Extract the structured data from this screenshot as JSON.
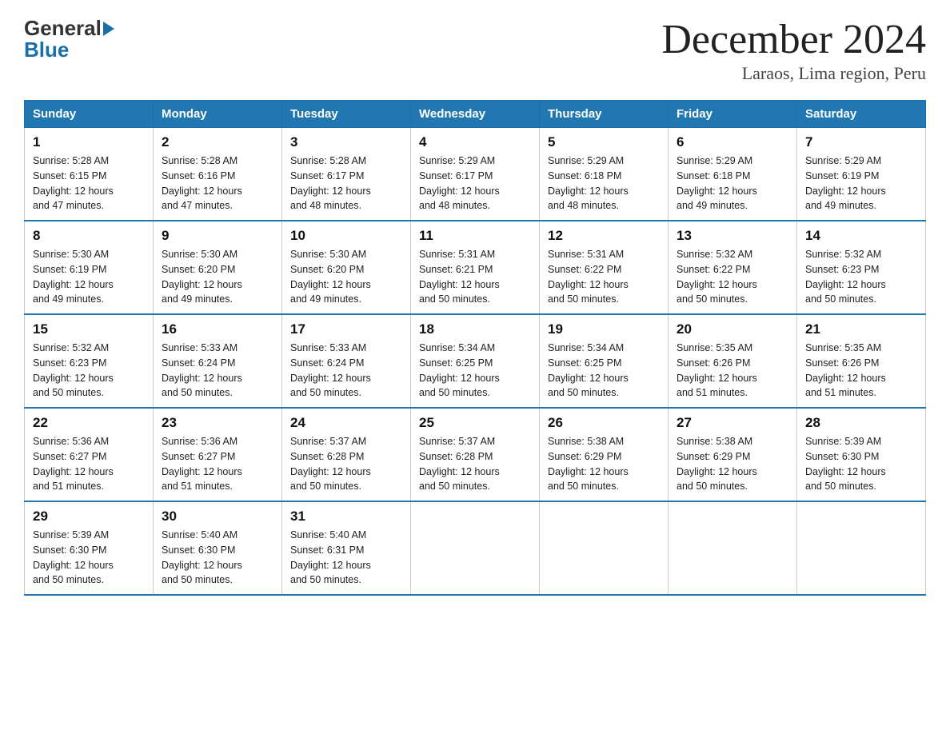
{
  "logo": {
    "general": "General",
    "blue": "Blue"
  },
  "title": "December 2024",
  "subtitle": "Laraos, Lima region, Peru",
  "days_of_week": [
    "Sunday",
    "Monday",
    "Tuesday",
    "Wednesday",
    "Thursday",
    "Friday",
    "Saturday"
  ],
  "weeks": [
    [
      {
        "day": "1",
        "sunrise": "5:28 AM",
        "sunset": "6:15 PM",
        "daylight": "12 hours and 47 minutes."
      },
      {
        "day": "2",
        "sunrise": "5:28 AM",
        "sunset": "6:16 PM",
        "daylight": "12 hours and 47 minutes."
      },
      {
        "day": "3",
        "sunrise": "5:28 AM",
        "sunset": "6:17 PM",
        "daylight": "12 hours and 48 minutes."
      },
      {
        "day": "4",
        "sunrise": "5:29 AM",
        "sunset": "6:17 PM",
        "daylight": "12 hours and 48 minutes."
      },
      {
        "day": "5",
        "sunrise": "5:29 AM",
        "sunset": "6:18 PM",
        "daylight": "12 hours and 48 minutes."
      },
      {
        "day": "6",
        "sunrise": "5:29 AM",
        "sunset": "6:18 PM",
        "daylight": "12 hours and 49 minutes."
      },
      {
        "day": "7",
        "sunrise": "5:29 AM",
        "sunset": "6:19 PM",
        "daylight": "12 hours and 49 minutes."
      }
    ],
    [
      {
        "day": "8",
        "sunrise": "5:30 AM",
        "sunset": "6:19 PM",
        "daylight": "12 hours and 49 minutes."
      },
      {
        "day": "9",
        "sunrise": "5:30 AM",
        "sunset": "6:20 PM",
        "daylight": "12 hours and 49 minutes."
      },
      {
        "day": "10",
        "sunrise": "5:30 AM",
        "sunset": "6:20 PM",
        "daylight": "12 hours and 49 minutes."
      },
      {
        "day": "11",
        "sunrise": "5:31 AM",
        "sunset": "6:21 PM",
        "daylight": "12 hours and 50 minutes."
      },
      {
        "day": "12",
        "sunrise": "5:31 AM",
        "sunset": "6:22 PM",
        "daylight": "12 hours and 50 minutes."
      },
      {
        "day": "13",
        "sunrise": "5:32 AM",
        "sunset": "6:22 PM",
        "daylight": "12 hours and 50 minutes."
      },
      {
        "day": "14",
        "sunrise": "5:32 AM",
        "sunset": "6:23 PM",
        "daylight": "12 hours and 50 minutes."
      }
    ],
    [
      {
        "day": "15",
        "sunrise": "5:32 AM",
        "sunset": "6:23 PM",
        "daylight": "12 hours and 50 minutes."
      },
      {
        "day": "16",
        "sunrise": "5:33 AM",
        "sunset": "6:24 PM",
        "daylight": "12 hours and 50 minutes."
      },
      {
        "day": "17",
        "sunrise": "5:33 AM",
        "sunset": "6:24 PM",
        "daylight": "12 hours and 50 minutes."
      },
      {
        "day": "18",
        "sunrise": "5:34 AM",
        "sunset": "6:25 PM",
        "daylight": "12 hours and 50 minutes."
      },
      {
        "day": "19",
        "sunrise": "5:34 AM",
        "sunset": "6:25 PM",
        "daylight": "12 hours and 50 minutes."
      },
      {
        "day": "20",
        "sunrise": "5:35 AM",
        "sunset": "6:26 PM",
        "daylight": "12 hours and 51 minutes."
      },
      {
        "day": "21",
        "sunrise": "5:35 AM",
        "sunset": "6:26 PM",
        "daylight": "12 hours and 51 minutes."
      }
    ],
    [
      {
        "day": "22",
        "sunrise": "5:36 AM",
        "sunset": "6:27 PM",
        "daylight": "12 hours and 51 minutes."
      },
      {
        "day": "23",
        "sunrise": "5:36 AM",
        "sunset": "6:27 PM",
        "daylight": "12 hours and 51 minutes."
      },
      {
        "day": "24",
        "sunrise": "5:37 AM",
        "sunset": "6:28 PM",
        "daylight": "12 hours and 50 minutes."
      },
      {
        "day": "25",
        "sunrise": "5:37 AM",
        "sunset": "6:28 PM",
        "daylight": "12 hours and 50 minutes."
      },
      {
        "day": "26",
        "sunrise": "5:38 AM",
        "sunset": "6:29 PM",
        "daylight": "12 hours and 50 minutes."
      },
      {
        "day": "27",
        "sunrise": "5:38 AM",
        "sunset": "6:29 PM",
        "daylight": "12 hours and 50 minutes."
      },
      {
        "day": "28",
        "sunrise": "5:39 AM",
        "sunset": "6:30 PM",
        "daylight": "12 hours and 50 minutes."
      }
    ],
    [
      {
        "day": "29",
        "sunrise": "5:39 AM",
        "sunset": "6:30 PM",
        "daylight": "12 hours and 50 minutes."
      },
      {
        "day": "30",
        "sunrise": "5:40 AM",
        "sunset": "6:30 PM",
        "daylight": "12 hours and 50 minutes."
      },
      {
        "day": "31",
        "sunrise": "5:40 AM",
        "sunset": "6:31 PM",
        "daylight": "12 hours and 50 minutes."
      },
      null,
      null,
      null,
      null
    ]
  ],
  "labels": {
    "sunrise": "Sunrise:",
    "sunset": "Sunset:",
    "daylight": "Daylight:"
  },
  "accent_color": "#2178b0"
}
